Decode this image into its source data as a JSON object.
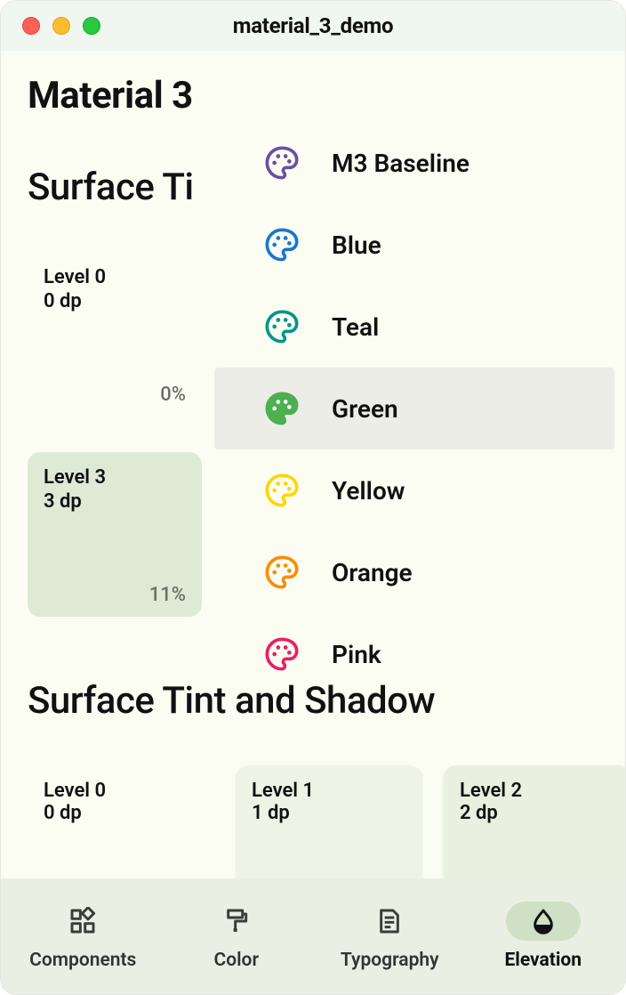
{
  "window": {
    "title": "material_3_demo"
  },
  "page": {
    "heading": "Material 3",
    "section1": "Surface Ti",
    "section2": "Surface Tint and Shadow"
  },
  "tiles": {
    "l0": {
      "level": "Level 0",
      "dp": "0 dp",
      "pct": "0%"
    },
    "l3": {
      "level": "Level 3",
      "dp": "3 dp",
      "pct": "11%"
    }
  },
  "tiles2": {
    "a": {
      "level": "Level 0",
      "dp": "0 dp"
    },
    "b": {
      "level": "Level 1",
      "dp": "1 dp"
    },
    "c": {
      "level": "Level 2",
      "dp": "2 dp"
    }
  },
  "colorMenu": {
    "items": [
      {
        "label": "M3 Baseline",
        "color": "#6750A4",
        "selected": false,
        "filled": false
      },
      {
        "label": "Blue",
        "color": "#1976D2",
        "selected": false,
        "filled": false
      },
      {
        "label": "Teal",
        "color": "#009688",
        "selected": false,
        "filled": false
      },
      {
        "label": "Green",
        "color": "#4CAF50",
        "selected": true,
        "filled": true
      },
      {
        "label": "Yellow",
        "color": "#FFD600",
        "selected": false,
        "filled": false
      },
      {
        "label": "Orange",
        "color": "#FB8C00",
        "selected": false,
        "filled": false
      },
      {
        "label": "Pink",
        "color": "#E91E63",
        "selected": false,
        "filled": false
      }
    ]
  },
  "nav": {
    "items": [
      {
        "label": "Components",
        "icon": "widgets",
        "active": false
      },
      {
        "label": "Color",
        "icon": "format_paint",
        "active": false
      },
      {
        "label": "Typography",
        "icon": "text_snippet",
        "active": false
      },
      {
        "label": "Elevation",
        "icon": "opacity",
        "active": true
      }
    ]
  }
}
